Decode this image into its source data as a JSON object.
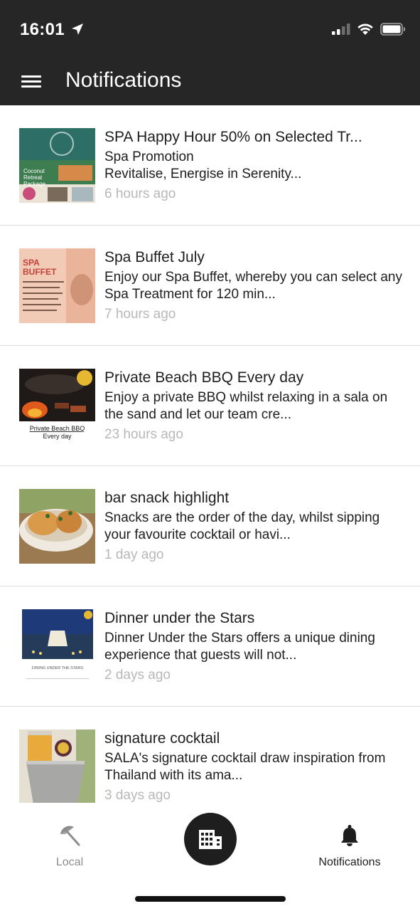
{
  "status_bar": {
    "time": "16:01",
    "icons": [
      "location-arrow-icon",
      "signal-icon",
      "wifi-icon",
      "battery-icon"
    ]
  },
  "header": {
    "title": "Notifications",
    "menu_icon": "hamburger-menu-icon",
    "background": "#262626"
  },
  "notifications": [
    {
      "title": "SPA Happy Hour 50% on Selected Tr...",
      "body": "Spa Promotion\nRevitalise, Energise in Serenity...",
      "time": "6 hours ago",
      "thumb_text": [
        "Coconut",
        "Retreat",
        "Package"
      ]
    },
    {
      "title": "Spa Buffet July",
      "body": "Enjoy our Spa Buffet, whereby you can select any Spa Treatment for 120 min...",
      "time": "7 hours ago",
      "thumb_text": [
        "SPA",
        "BUFFET"
      ]
    },
    {
      "title": "Private Beach BBQ Every day",
      "body": "Enjoy a private BBQ whilst relaxing in a sala on the sand and let our team cre...",
      "time": "23 hours ago",
      "thumb_text": [
        "Private Beach BBQ",
        "Every day"
      ]
    },
    {
      "title": "bar snack highlight",
      "body": "Snacks are the order of the day, whilst sipping your favourite cocktail or havi...",
      "time": "1 day ago",
      "thumb_text": []
    },
    {
      "title": "Dinner under the Stars",
      "body": "Dinner Under the Stars offers a unique dining experience that guests will not...",
      "time": "2 days ago",
      "thumb_text": [
        "DINING UNDER THE STARS"
      ]
    },
    {
      "title": "signature cocktail",
      "body": "SALA's signature cocktail draw inspiration from Thailand with its ama...",
      "time": "3 days ago",
      "thumb_text": []
    }
  ],
  "tab_bar": {
    "local_label": "Local",
    "local_icon": "beach-umbrella-icon",
    "center_icon": "building-icon",
    "notifications_label": "Notifications",
    "notifications_icon": "bell-icon",
    "active_color": "#1e1e1e",
    "inactive_color": "#8d8d8d"
  }
}
